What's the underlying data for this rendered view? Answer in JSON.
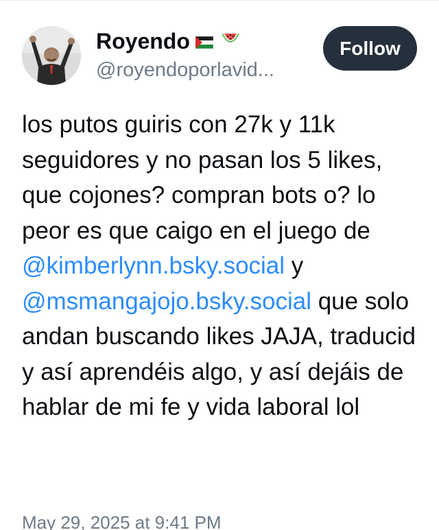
{
  "post": {
    "author": {
      "display_name": "Royendo",
      "name_emojis": [
        "palestine-flag",
        "watermelon"
      ],
      "handle": "@royendoporlavid..."
    },
    "follow_label": "Follow",
    "text_parts": {
      "p1": "los putos guiris con 27k y 11k seguidores y no pasan los 5 likes, que cojones? compran bots o? lo peor es que caigo en el juego de ",
      "mention1": "@kimberlynn.bsky.social",
      "p2": " y ",
      "mention2": "@msmangajojo.bsky.social",
      "p3": " que solo andan buscando likes JAJA, traducid y así aprendéis algo, y así dejáis de hablar de mi fe y vida laboral lol"
    },
    "timestamp": "May 29, 2025 at 9:41 PM"
  },
  "colors": {
    "mention": "#2b8cff",
    "follow_button_bg": "#25303d",
    "secondary_text": "#6e7a87"
  }
}
